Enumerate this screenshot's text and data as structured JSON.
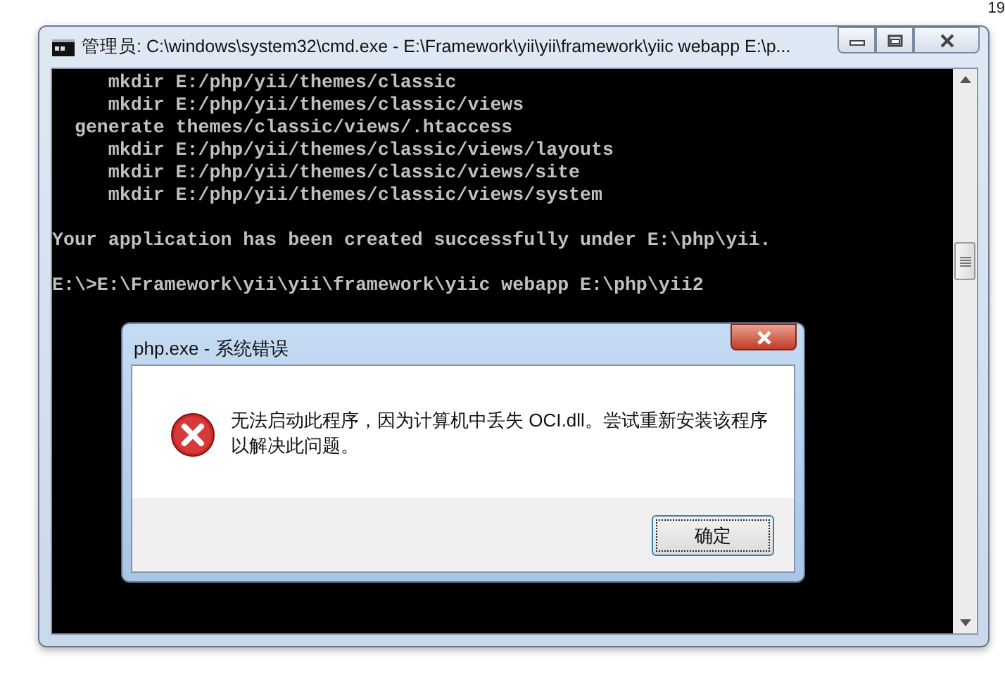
{
  "corner_text": "19",
  "console_window": {
    "title": "管理员: C:\\windows\\system32\\cmd.exe - E:\\Framework\\yii\\yii\\framework\\yiic  webapp E:\\p...",
    "blocks": [
      [
        "     mkdir E:/php/yii/themes/classic",
        "     mkdir E:/php/yii/themes/classic/views",
        "  generate themes/classic/views/.htaccess",
        "     mkdir E:/php/yii/themes/classic/views/layouts",
        "     mkdir E:/php/yii/themes/classic/views/site",
        "     mkdir E:/php/yii/themes/classic/views/system"
      ],
      [
        "Your application has been created successfully under E:\\php\\yii."
      ],
      [
        "E:\\>E:\\Framework\\yii\\yii\\framework\\yiic webapp E:\\php\\yii2"
      ]
    ]
  },
  "dialog": {
    "title": "php.exe - 系统错误",
    "message": "无法启动此程序，因为计算机中丢失 OCI.dll。尝试重新安装该程序以解决此问题。",
    "buttons": [
      {
        "label": "确定",
        "focused": true
      }
    ]
  }
}
